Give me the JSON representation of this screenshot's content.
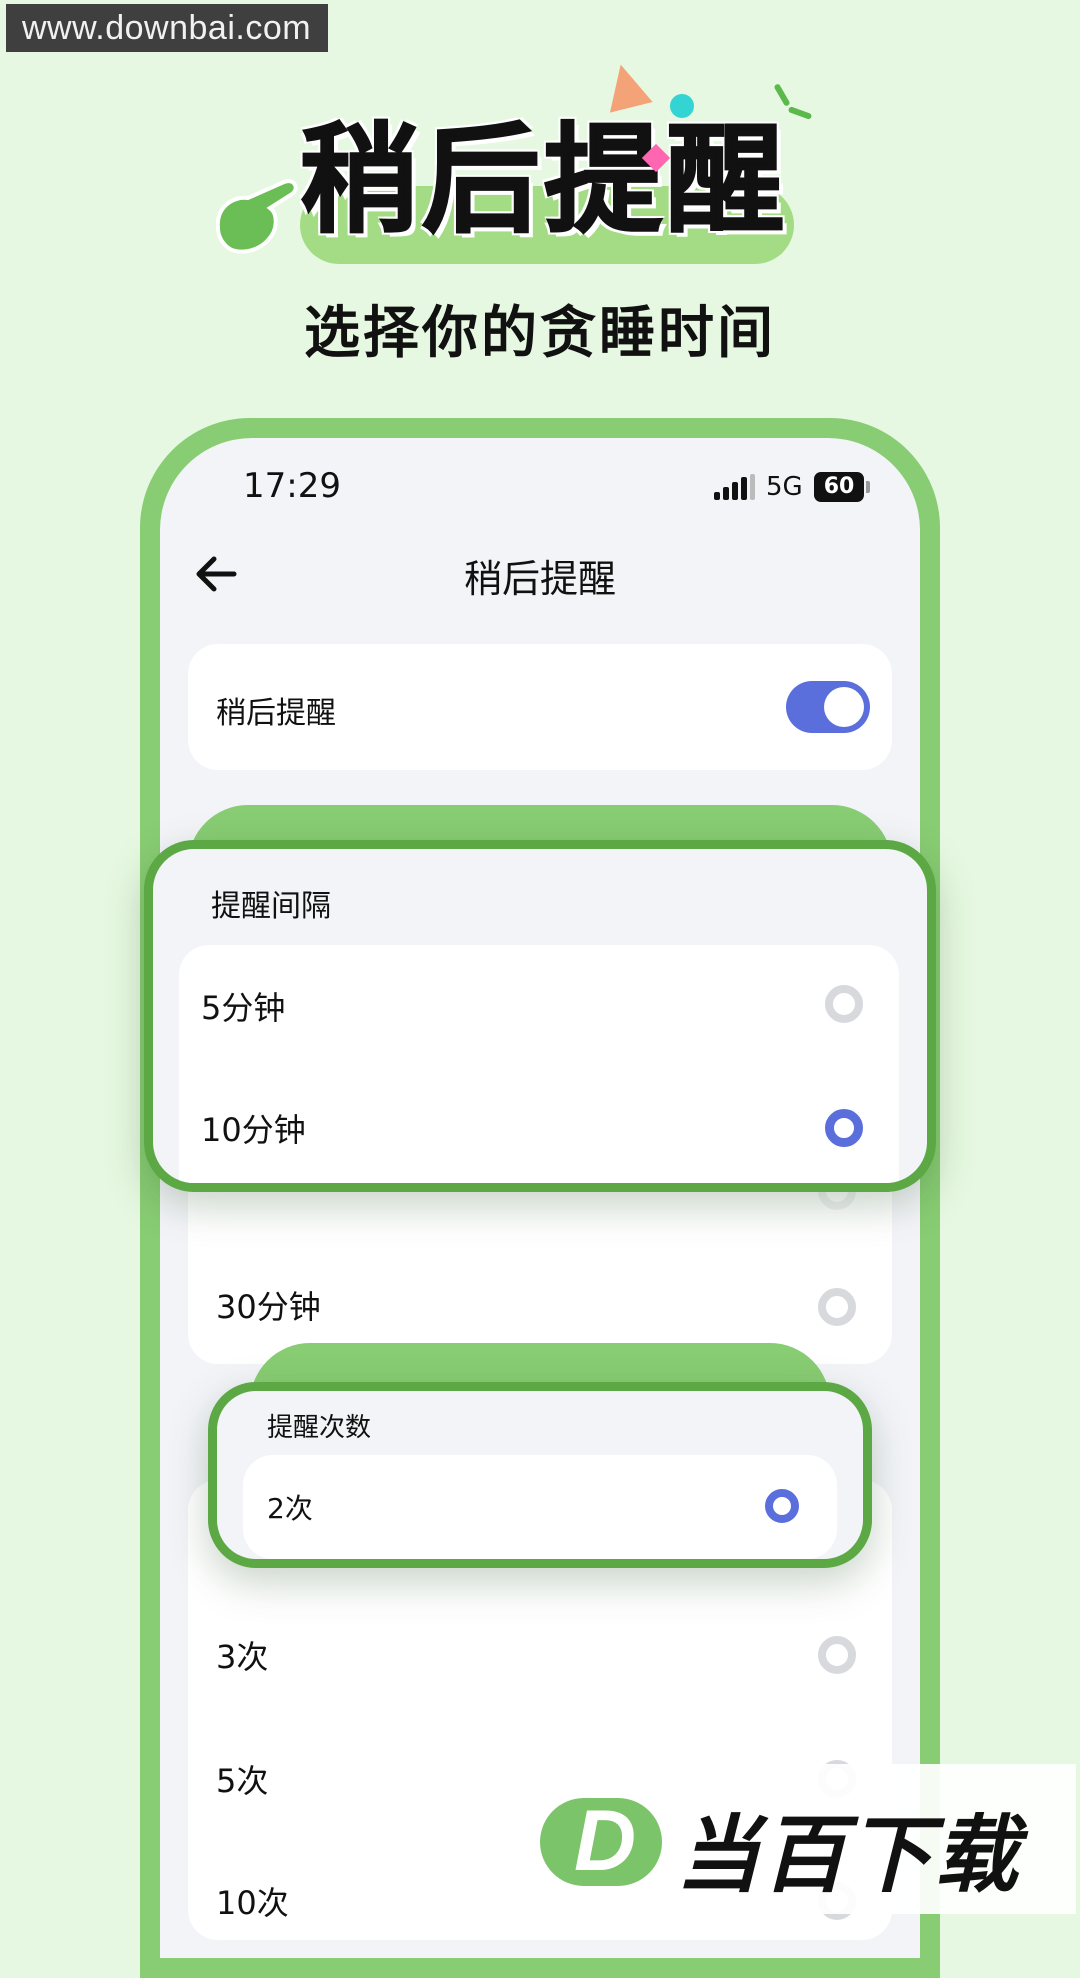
{
  "watermark_top": "www.downbai.com",
  "header": {
    "title": "稍后提醒",
    "subtitle": "选择你的贪睡时间"
  },
  "status_bar": {
    "time": "17:29",
    "network": "5G",
    "battery": "60"
  },
  "nav": {
    "title": "稍后提醒"
  },
  "snooze_toggle": {
    "label": "稍后提醒",
    "enabled": true
  },
  "interval_section": {
    "title": "提醒间隔",
    "options": [
      {
        "label": "5分钟",
        "selected": false
      },
      {
        "label": "10分钟",
        "selected": true
      },
      {
        "label": "30分钟",
        "selected": false
      }
    ]
  },
  "count_section": {
    "title": "提醒次数",
    "options": [
      {
        "label": "2次",
        "selected": true
      },
      {
        "label": "3次",
        "selected": false
      },
      {
        "label": "5次",
        "selected": false
      },
      {
        "label": "10次",
        "selected": false
      }
    ]
  },
  "watermark_bottom": {
    "logo_letter": "D",
    "text": "当百下载"
  },
  "colors": {
    "background": "#e6f8e1",
    "frame_green": "#88cc73",
    "popup_border": "#5ca844",
    "accent_blue": "#5a6fdc"
  }
}
